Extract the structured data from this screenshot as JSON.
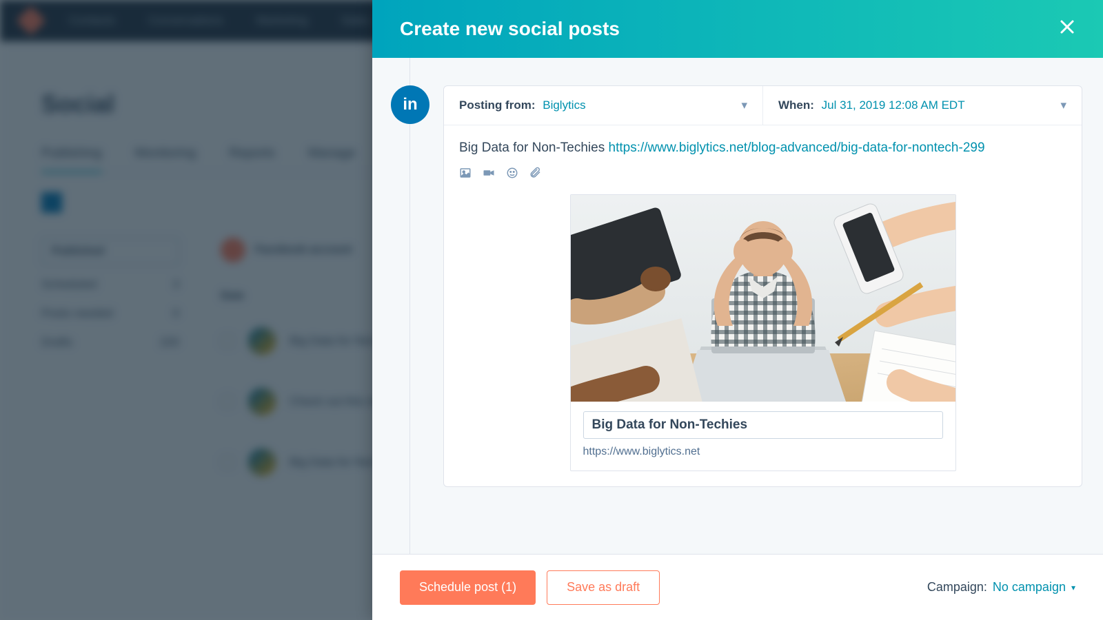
{
  "background": {
    "nav": [
      "Contacts",
      "Conversations",
      "Marketing",
      "Sales"
    ],
    "page_title": "Social",
    "tabs": [
      "Publishing",
      "Monitoring",
      "Reports",
      "Manage"
    ],
    "sidebar": {
      "status_label": "Published",
      "rows": [
        {
          "label": "Scheduled",
          "count": "3"
        },
        {
          "label": "Posts needed",
          "count": "0"
        },
        {
          "label": "Drafts",
          "count": "220"
        }
      ]
    },
    "list_header": "Facebook account",
    "date_label": "Date"
  },
  "panel": {
    "title": "Create new social posts",
    "network_abbr": "in",
    "posting_from": {
      "label": "Posting from:",
      "value": "Biglytics"
    },
    "when": {
      "label": "When:",
      "value": "Jul 31, 2019 12:08 AM EDT"
    },
    "post": {
      "text": "Big Data for Non-Techies ",
      "link": "https://www.biglytics.net/blog-advanced/big-data-for-nontech-299"
    },
    "preview": {
      "title": "Big Data for Non-Techies",
      "url": "https://www.biglytics.net"
    }
  },
  "footer": {
    "schedule_label": "Schedule post (1)",
    "draft_label": "Save as draft",
    "campaign_label": "Campaign:",
    "campaign_value": "No campaign"
  }
}
